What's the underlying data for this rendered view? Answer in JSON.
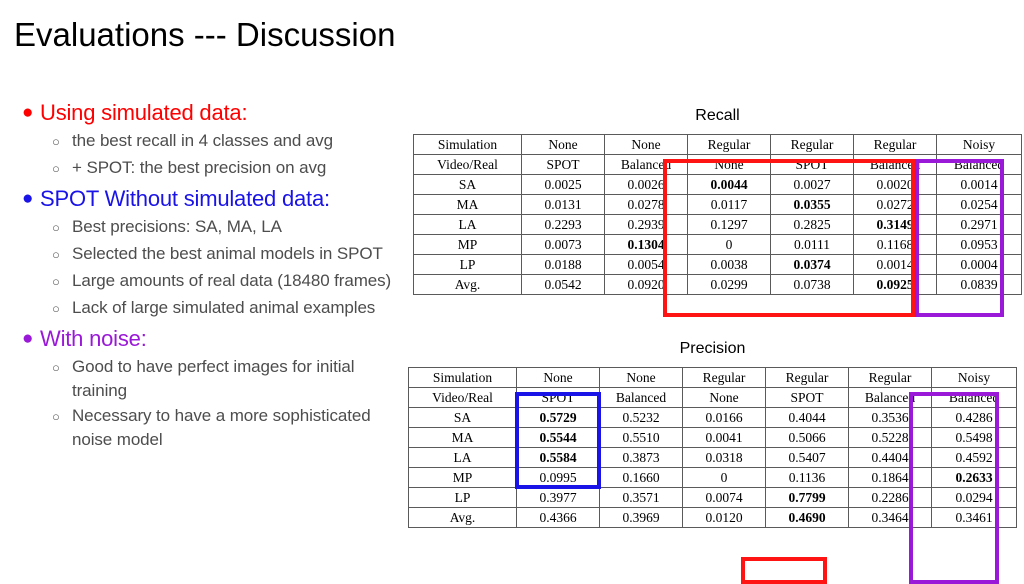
{
  "slide": {
    "title": "Evaluations --- Discussion"
  },
  "colors": {
    "red": "#ff0000",
    "blue": "#1a13e8",
    "purple": "#9a18d8",
    "body_text": "#4d4d4d",
    "table_border": "#5a5a5a"
  },
  "bullets": [
    {
      "label": "Using simulated data:",
      "color": "red",
      "marker": "●",
      "sub_marker": "○",
      "children": [
        "the best recall in 4 classes and avg",
        "+ SPOT: the best precision on avg"
      ]
    },
    {
      "label": "SPOT Without simulated data:",
      "color": "blue",
      "marker": "●",
      "sub_marker": "○",
      "children": [
        "Best precisions: SA, MA, LA",
        "Selected the best animal models in SPOT",
        "Large amounts of real data (18480 frames)",
        "Lack of large simulated animal examples"
      ]
    },
    {
      "label": "With noise:",
      "color": "purple",
      "marker": "●",
      "sub_marker": "○",
      "children": [
        "Good to have perfect images for initial training",
        "Necessary to have a more sophisticated noise model"
      ]
    }
  ],
  "recall_table": {
    "caption": "Recall",
    "header_row_1": [
      "Simulation",
      "None",
      "None",
      "Regular",
      "Regular",
      "Regular",
      "Noisy"
    ],
    "header_row_2": [
      "Video/Real",
      "SPOT",
      "Balanced",
      "None",
      "SPOT",
      "Balanced",
      "Balanced"
    ],
    "rows": [
      {
        "label": "SA",
        "values": [
          "0.0025",
          "0.0026",
          "0.0044",
          "0.0027",
          "0.0020",
          "0.0014"
        ],
        "bold": [
          false,
          false,
          true,
          false,
          false,
          false
        ]
      },
      {
        "label": "MA",
        "values": [
          "0.0131",
          "0.0278",
          "0.0117",
          "0.0355",
          "0.0272",
          "0.0254"
        ],
        "bold": [
          false,
          false,
          false,
          true,
          false,
          false
        ]
      },
      {
        "label": "LA",
        "values": [
          "0.2293",
          "0.2939",
          "0.1297",
          "0.2825",
          "0.3149",
          "0.2971"
        ],
        "bold": [
          false,
          false,
          false,
          false,
          true,
          false
        ]
      },
      {
        "label": "MP",
        "values": [
          "0.0073",
          "0.1304",
          "0",
          "0.0111",
          "0.1168",
          "0.0953"
        ],
        "bold": [
          false,
          true,
          false,
          false,
          false,
          false
        ]
      },
      {
        "label": "LP",
        "values": [
          "0.0188",
          "0.0054",
          "0.0038",
          "0.0374",
          "0.0014",
          "0.0004"
        ],
        "bold": [
          false,
          false,
          false,
          true,
          false,
          false
        ]
      },
      {
        "label": "Avg.",
        "values": [
          "0.0542",
          "0.0920",
          "0.0299",
          "0.0738",
          "0.0925",
          "0.0839"
        ],
        "bold": [
          false,
          false,
          false,
          false,
          true,
          false
        ]
      }
    ],
    "highlights": [
      {
        "name": "regular-group",
        "color": "red",
        "covers": "Regular None / Regular SPOT / Regular Balanced columns, all rows"
      },
      {
        "name": "noisy-group",
        "color": "purple",
        "covers": "Noisy Balanced column, all rows"
      }
    ]
  },
  "precision_table": {
    "caption": "Precision",
    "header_row_1": [
      "Simulation",
      "None",
      "None",
      "Regular",
      "Regular",
      "Regular",
      "Noisy"
    ],
    "header_row_2": [
      "Video/Real",
      "SPOT",
      "Balanced",
      "None",
      "SPOT",
      "Balanced",
      "Balanced"
    ],
    "rows": [
      {
        "label": "SA",
        "values": [
          "0.5729",
          "0.5232",
          "0.0166",
          "0.4044",
          "0.3536",
          "0.4286"
        ],
        "bold": [
          true,
          false,
          false,
          false,
          false,
          false
        ]
      },
      {
        "label": "MA",
        "values": [
          "0.5544",
          "0.5510",
          "0.0041",
          "0.5066",
          "0.5228",
          "0.5498"
        ],
        "bold": [
          true,
          false,
          false,
          false,
          false,
          false
        ]
      },
      {
        "label": "LA",
        "values": [
          "0.5584",
          "0.3873",
          "0.0318",
          "0.5407",
          "0.4404",
          "0.4592"
        ],
        "bold": [
          true,
          false,
          false,
          false,
          false,
          false
        ]
      },
      {
        "label": "MP",
        "values": [
          "0.0995",
          "0.1660",
          "0",
          "0.1136",
          "0.1864",
          "0.2633"
        ],
        "bold": [
          false,
          false,
          false,
          false,
          false,
          true
        ]
      },
      {
        "label": "LP",
        "values": [
          "0.3977",
          "0.3571",
          "0.0074",
          "0.7799",
          "0.2286",
          "0.0294"
        ],
        "bold": [
          false,
          false,
          false,
          true,
          false,
          false
        ]
      },
      {
        "label": "Avg.",
        "values": [
          "0.4366",
          "0.3969",
          "0.0120",
          "0.4690",
          "0.3464",
          "0.3461"
        ],
        "bold": [
          false,
          false,
          false,
          true,
          false,
          false
        ]
      }
    ],
    "highlights": [
      {
        "name": "none-spot-group",
        "color": "blue",
        "covers": "None SPOT column, header through LA row"
      },
      {
        "name": "noisy-group",
        "color": "purple",
        "covers": "Noisy Balanced column, all rows"
      },
      {
        "name": "avg-regular-spot",
        "color": "red",
        "covers": "Regular SPOT column, Avg. row only"
      }
    ]
  }
}
